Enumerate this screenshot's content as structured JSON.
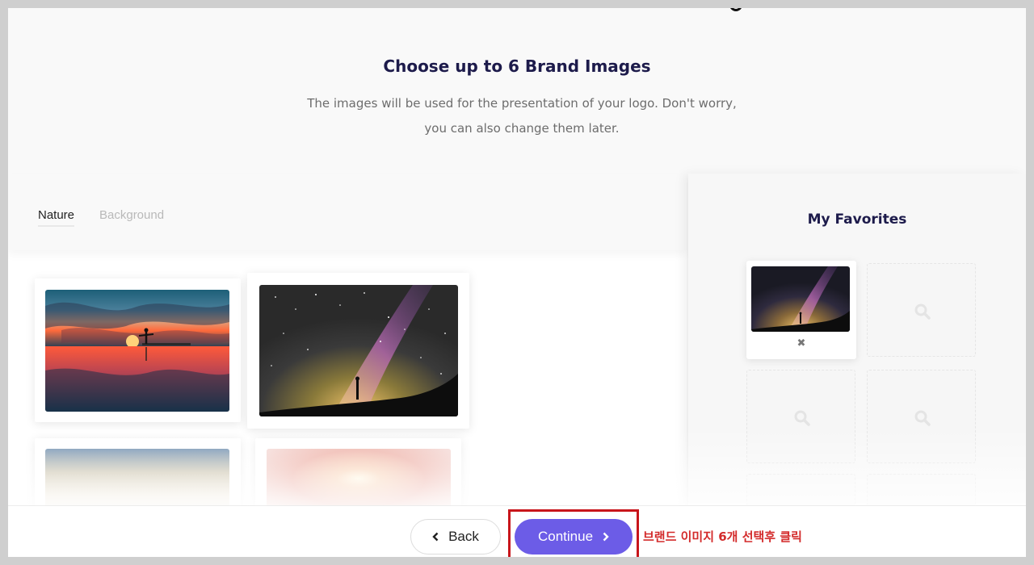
{
  "header": {
    "title": "Choose up to 6 Brand Images",
    "subtitle": "The images will be used for the presentation of your logo. Don't worry, you can also change them later."
  },
  "tabs": [
    {
      "label": "Nature",
      "active": true
    },
    {
      "label": "Background",
      "active": false
    }
  ],
  "gallery": {
    "images": [
      {
        "description": "sunset-reflection-person"
      },
      {
        "description": "milky-way-silhouette"
      },
      {
        "description": "sky-clouds-pale"
      },
      {
        "description": "pink-sunset-haze"
      }
    ]
  },
  "favorites": {
    "title": "My Favorites",
    "filled_slots": 1,
    "total_slots": 6,
    "remove_symbol": "✖"
  },
  "footer": {
    "back_label": "Back",
    "continue_label": "Continue"
  },
  "annotation": {
    "text": "브랜드 이미지 6개 선택후 클릭",
    "color": "#d32a2a"
  },
  "colors": {
    "accent": "#6c5ce7",
    "title": "#1d1b4b",
    "highlight": "#c8151b"
  }
}
